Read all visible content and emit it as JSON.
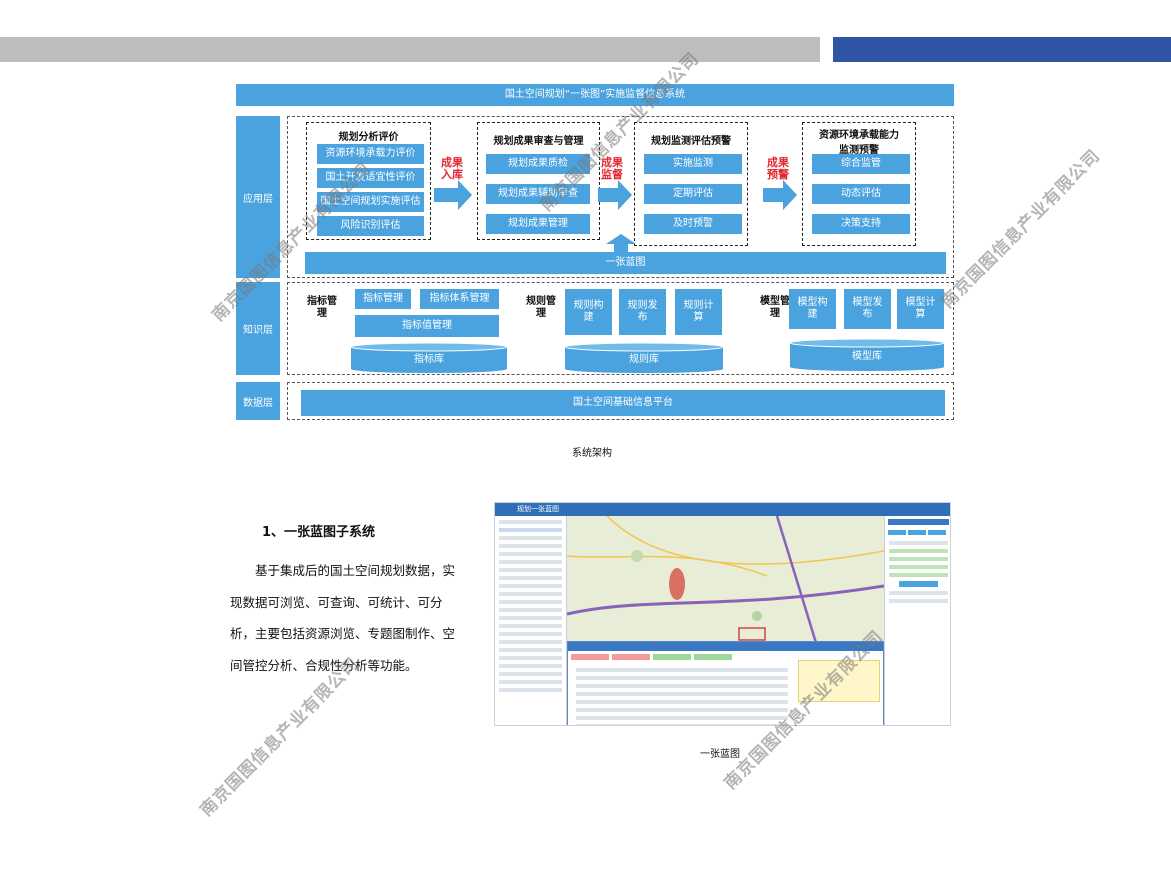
{
  "architecture": {
    "title": "国土空间规划“一张图”实施监督信息系统",
    "layers": {
      "app": "应用层",
      "knowledge": "知识层",
      "data": "数据层"
    },
    "groups": {
      "analysis": {
        "title": "规划分析评价",
        "items": [
          "资源环境承载力评价",
          "国土开发适宜性评价",
          "国土空间规划实施评估",
          "风险识别评估"
        ]
      },
      "review": {
        "title": "规划成果审查与管理",
        "items": [
          "规划成果质检",
          "规划成果辅助审查",
          "规划成果管理"
        ]
      },
      "monitor": {
        "title": "规划监测评估预警",
        "items": [
          "实施监测",
          "定期评估",
          "及时预警"
        ]
      },
      "capacity": {
        "title": "资源环境承载能力监测预警",
        "items": [
          "综合监管",
          "动态评估",
          "决策支持"
        ]
      }
    },
    "arrows": {
      "a1": "成果入库",
      "a2": "成果监督",
      "a3": "成果预警"
    },
    "one_map": "一张蓝图",
    "knowledge": {
      "indicator": {
        "label": "指标管理",
        "b1": "指标管理",
        "b2": "指标体系管理",
        "b3": "指标值管理",
        "db": "指标库"
      },
      "rule": {
        "label": "规则管理",
        "b1": "规则构建",
        "b2": "规则发布",
        "b3": "规则计算",
        "db": "规则库"
      },
      "model": {
        "label": "模型管理",
        "b1": "模型构建",
        "b2": "模型发布",
        "b3": "模型计算",
        "db": "模型库"
      }
    },
    "platform": "国土空间基础信息平台",
    "caption": "系统架构"
  },
  "section": {
    "heading": "1、一张蓝图子系统",
    "paragraph": "基于集成后的国土空间规划数据，实现数据可浏览、可查询、可统计、可分析，主要包括资源浏览、专题图制作、空间管控分析、合规性分析等功能。"
  },
  "screenshot": {
    "app_title": "规划一张蓝图",
    "caption": "一张蓝图"
  },
  "watermark": "南京国图信息产业有限公司",
  "colors": {
    "accent": "#4aa3df",
    "header_blue": "#2f55a4",
    "arrow_red": "#e3262f"
  }
}
